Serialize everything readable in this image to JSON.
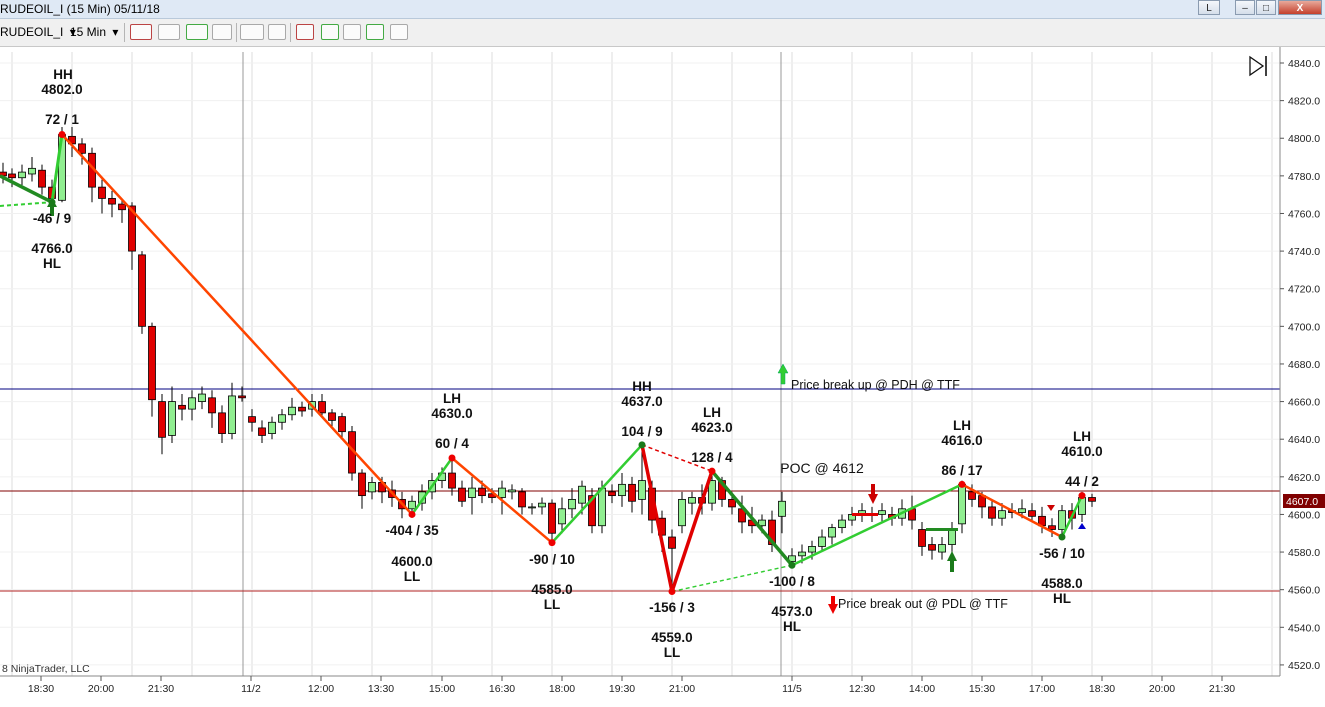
{
  "window": {
    "title": "RUDEOIL_I (15 Min)  05/11/18",
    "buttons": [
      "L",
      "–",
      "□",
      "X"
    ]
  },
  "toolbar": {
    "instrument": "RUDEOIL_I",
    "interval": "15 Min",
    "dropdown_glyph": "▾"
  },
  "colors": {
    "up_candle": "#90ee90",
    "down_candle": "#e00000",
    "zigzag_up": "#32cd32",
    "zigzag_down": "#ff4500",
    "zigzag_dark_up": "#228b22",
    "zigzag_dark_down": "#e00000",
    "pdh_line": "#000080",
    "pdl_line": "#b22222",
    "price_badge": "#800000"
  },
  "chart": {
    "copyright": "8 NinjaTrader, LLC",
    "last_price": "4607.0",
    "price_ticks": [
      "4840.0",
      "4820.0",
      "4800.0",
      "4780.0",
      "4760.0",
      "4740.0",
      "4720.0",
      "4700.0",
      "4680.0",
      "4660.0",
      "4640.0",
      "4620.0",
      "4600.0",
      "4580.0",
      "4560.0",
      "4540.0",
      "4520.0"
    ],
    "time_ticks": [
      "18:30",
      "20:00",
      "21:30",
      "11/2",
      "12:00",
      "13:30",
      "15:00",
      "16:30",
      "18:00",
      "19:30",
      "21:00",
      "11/5",
      "12:30",
      "14:00",
      "15:30",
      "17:00",
      "18:30",
      "20:00",
      "21:30"
    ],
    "annotations": {
      "hh1": "HH",
      "hh1_price": "4802.0",
      "sw1": "72 / 1",
      "sw2": "-46 / 9",
      "hl1_price": "4766.0",
      "hl1": "HL",
      "lh2": "LH",
      "lh2_price": "4630.0",
      "sw3": "60 / 4",
      "sw4": "-404 / 35",
      "ll1_price": "4600.0",
      "ll1": "LL",
      "sw5": "-90 / 10",
      "ll2_price": "4585.0",
      "ll2": "LL",
      "hh2": "HH",
      "hh2_price": "4637.0",
      "sw6": "104 / 9",
      "sw7": "-156 / 3",
      "ll3_price": "4559.0",
      "ll3": "LL",
      "lh3": "LH",
      "lh3_price": "4623.0",
      "sw8": "128 / 4",
      "poc": "POC @ 4612",
      "sw9": "-100 / 8",
      "hl2_price": "4573.0",
      "hl2": "HL",
      "break_up": "Price break up @ PDH @ TTF",
      "break_out": "Price break out @ PDL @ TTF",
      "lh4": "LH",
      "lh4_price": "4616.0",
      "sw10": "86 / 17",
      "lh5": "LH",
      "lh5_price": "4610.0",
      "sw11": "44 / 2",
      "sw12": "-56 / 10",
      "hl3_price": "4588.0",
      "hl3": "HL"
    }
  }
}
